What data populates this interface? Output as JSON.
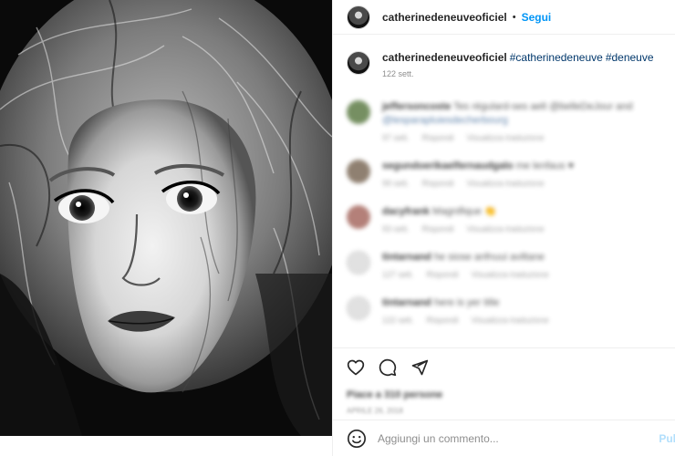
{
  "post": {
    "username": "catherinedeneuveoficiel",
    "separator": "•",
    "follow_label": "Segui"
  },
  "caption": {
    "username": "catherinedeneuveoficiel",
    "hashtags": [
      "#catherinedeneuve",
      "#deneuve"
    ],
    "time": "122 sett."
  },
  "comments": [
    {
      "user": "jeffersoncoste",
      "text": "Tes régulard-ses aelt @belleDeJour and",
      "text2": "@lesparapluiesdecherbourg",
      "time": "97 sett.",
      "reply": "Rispondi",
      "translate": "Visualizza traduzione",
      "avatar_color": "#6f8a5a"
    },
    {
      "user": "segundoerikaelfernaudgalo",
      "text": "me lenfaus ♥",
      "text2": "",
      "time": "99 sett.",
      "reply": "Rispondi",
      "translate": "Visualizza traduzione",
      "avatar_color": "#8a7a6a"
    },
    {
      "user": "dacyfrank",
      "text": "Magnifique 👏",
      "text2": "",
      "time": "93 sett.",
      "reply": "Rispondi",
      "translate": "Visualizza traduzione",
      "avatar_color": "#b07a72"
    },
    {
      "user": "tintarnand",
      "text": "he siose anfnuui aviltane",
      "text2": "",
      "time": "127 sett.",
      "reply": "Rispondi",
      "translate": "Visualizza traduzione",
      "avatar_color": "#d4d4d4"
    },
    {
      "user": "tintarnand",
      "text": "here is yer title",
      "text2": "",
      "time": "122 sett.",
      "reply": "Rispondi",
      "translate": "Visualizza traduzione",
      "avatar_color": "#d4d4d4"
    }
  ],
  "actions": {
    "like_icon": "heart-icon",
    "comment_icon": "comment-icon",
    "share_icon": "paper-plane-icon"
  },
  "likes_text": "Piace a 310 persone",
  "date_text": "APRILE 26, 2018",
  "comment_box": {
    "placeholder": "Aggiungi un commento...",
    "publish_label": "Pul",
    "emoji_icon": "smiley-icon"
  }
}
